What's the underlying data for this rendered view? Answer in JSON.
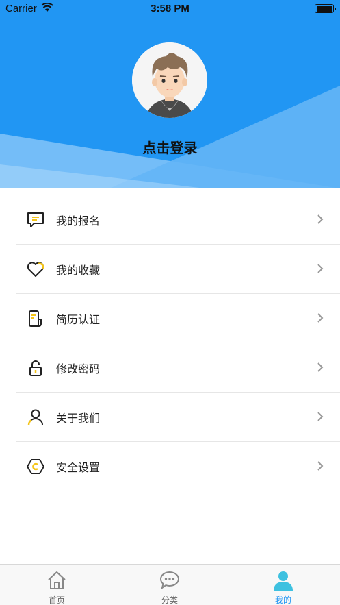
{
  "status_bar": {
    "carrier": "Carrier",
    "time": "3:58 PM"
  },
  "profile": {
    "login_text": "点击登录"
  },
  "menu": {
    "items": [
      {
        "label": "我的报名",
        "icon": "message-icon"
      },
      {
        "label": "我的收藏",
        "icon": "heart-icon"
      },
      {
        "label": "简历认证",
        "icon": "resume-icon"
      },
      {
        "label": "修改密码",
        "icon": "lock-icon"
      },
      {
        "label": "关于我们",
        "icon": "user-icon"
      },
      {
        "label": "安全设置",
        "icon": "hexagon-settings-icon"
      }
    ]
  },
  "tabbar": {
    "tabs": [
      {
        "label": "首页",
        "icon": "home-icon",
        "active": false
      },
      {
        "label": "分类",
        "icon": "chat-bubble-icon",
        "active": false
      },
      {
        "label": "我的",
        "icon": "profile-icon",
        "active": true
      }
    ]
  },
  "colors": {
    "primary": "#2196f3",
    "accent_yellow": "#f5c518"
  }
}
